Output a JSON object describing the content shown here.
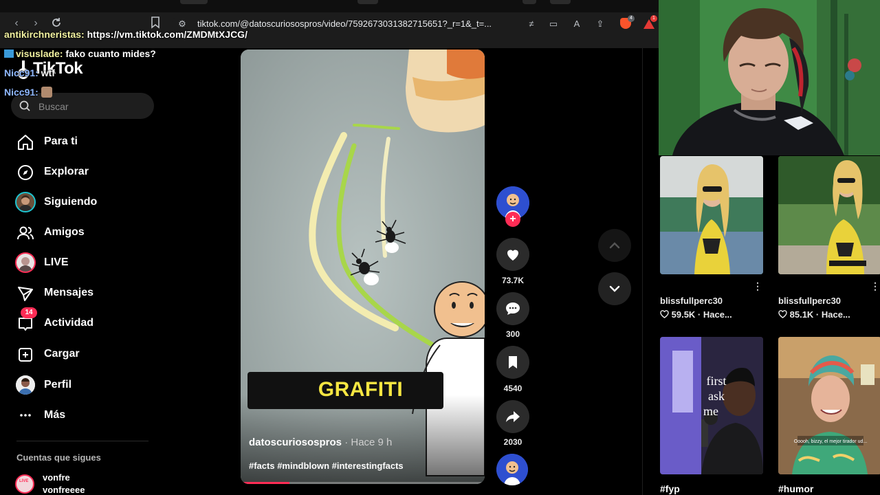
{
  "browser": {
    "url": "tiktok.com/@datoscuriosospros/video/7592673031382715651?_r=1&_t=...",
    "brave_badge": "4",
    "ext_badge": "1"
  },
  "chat": [
    {
      "user": "antikirchneristas:",
      "message": "https://vm.tiktok.com/ZMDMtXJCG/"
    },
    {
      "user": "visuslade:",
      "message": "fako cuanto mides?"
    },
    {
      "user": "Nicc91:",
      "message": "wtf"
    },
    {
      "user": "Nicc91:",
      "message": ""
    }
  ],
  "sidebar": {
    "logo_text": "TikTok",
    "search_placeholder": "Buscar",
    "items": [
      {
        "label": "Para ti",
        "icon": "home-icon"
      },
      {
        "label": "Explorar",
        "icon": "compass-icon"
      },
      {
        "label": "Siguiendo",
        "icon": "following-avatar"
      },
      {
        "label": "Amigos",
        "icon": "friends-icon"
      },
      {
        "label": "LIVE",
        "icon": "live-avatar"
      },
      {
        "label": "Mensajes",
        "icon": "send-icon"
      },
      {
        "label": "Actividad",
        "icon": "inbox-icon",
        "badge": "14"
      },
      {
        "label": "Cargar",
        "icon": "upload-icon"
      },
      {
        "label": "Perfil",
        "icon": "profile-avatar"
      },
      {
        "label": "Más",
        "icon": "more-icon"
      }
    ],
    "following_title": "Cuentas que sigues",
    "following": [
      {
        "name": "vonfre",
        "handle": "vonfreeee",
        "live_label": "LIVE"
      }
    ]
  },
  "video": {
    "caption": "GRAFITI",
    "author": "datoscuriosospros",
    "time": "· Hace 9 h",
    "hashtags": "#facts #mindblown #interestingfacts",
    "progress": 0.2
  },
  "actions": {
    "likes": "73.7K",
    "comments": "300",
    "saves": "4540",
    "shares": "2030"
  },
  "grid": [
    {
      "user": "blissfullperc30",
      "stats": "59.5K · Hace..."
    },
    {
      "user": "blissfullperc30",
      "stats": "85.1K · Hace..."
    },
    {
      "tag": "#fyp",
      "overlay_text": "first ask me"
    },
    {
      "tag": "#humor",
      "overlay_text": "Ooooh, bizzy, el mejor tirador ud..."
    }
  ],
  "colors": {
    "accent": "#fe2c55",
    "background": "#000000",
    "caption_yellow": "#f5e642"
  }
}
